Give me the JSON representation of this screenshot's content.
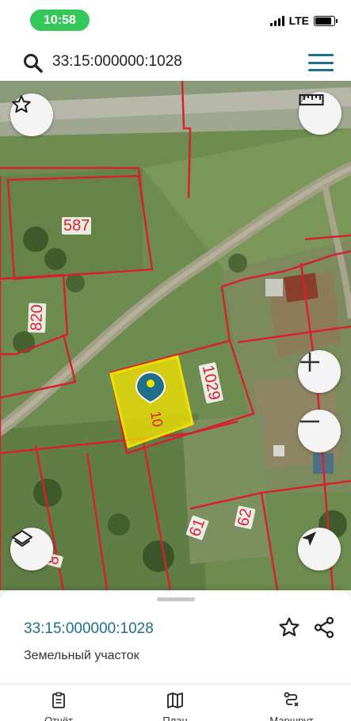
{
  "status_bar": {
    "time": "10:58",
    "network": "LTE",
    "battery_level": 0.85
  },
  "search": {
    "query": "33:15:000000:1028"
  },
  "map": {
    "parcels": [
      {
        "label": "587"
      },
      {
        "label": "820"
      },
      {
        "label": "1029"
      },
      {
        "label": "61"
      },
      {
        "label": "62"
      },
      {
        "label": "8"
      }
    ],
    "selected_parcel_partial_label": "10",
    "colors": {
      "parcel_border": "#d8212f",
      "selected_fill": "#f5e400",
      "pin": "#1f6f8b"
    },
    "icons": {
      "favorite": "star-outline-icon",
      "ruler": "ruler-icon",
      "zoom_in": "plus-icon",
      "zoom_out": "minus-icon",
      "layers": "layers-icon",
      "locate": "navigation-arrow-icon"
    }
  },
  "sheet": {
    "title": "33:15:000000:1028",
    "subtitle": "Земельный участок"
  },
  "tabs": [
    {
      "label": "Отчёт",
      "icon": "clipboard-icon"
    },
    {
      "label": "План",
      "icon": "map-icon"
    },
    {
      "label": "Маршрут",
      "icon": "route-icon"
    }
  ],
  "accent_color": "#1f6f8b"
}
